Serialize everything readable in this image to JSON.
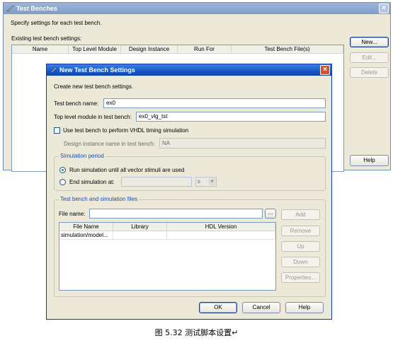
{
  "back_window": {
    "title": "Test Benches",
    "subtitle": "Specify settings for each test bench.",
    "existing_label": "Existing test bench settings:",
    "columns": [
      "Name",
      "Top Level Module",
      "Design Instance",
      "Run For",
      "Test Bench File(s)"
    ],
    "buttons": {
      "new": "New...",
      "edit": "Edit...",
      "delete": "Delete",
      "help": "Help"
    }
  },
  "dialog": {
    "title": "New Test Bench Settings",
    "intro": "Create new test bench settings.",
    "test_bench_name_label": "Test bench name:",
    "test_bench_name_value": "ex0",
    "top_level_label": "Top level module in test bench:",
    "top_level_value": "ex0_vlg_tst",
    "use_vhdl_label": "Use test bench to perform VHDL timing simulation",
    "use_vhdl_checked": false,
    "design_instance_label": "Design instance name in test bench:",
    "design_instance_value": "NA",
    "sim_period": {
      "title": "Simulation period",
      "run_until_label": "Run simulation until all vector stimuli are used",
      "run_until_checked": true,
      "end_at_label": "End simulation at:",
      "end_at_value": "",
      "end_at_unit": "s"
    },
    "files": {
      "title": "Test bench and simulation files",
      "file_name_label": "File name:",
      "file_name_value": "",
      "browse_label": "...",
      "columns": [
        "File Name",
        "Library",
        "HDL Version"
      ],
      "rows": [
        {
          "file_name": "simulation/model...",
          "library": "",
          "hdl_version": ""
        }
      ],
      "buttons": {
        "add": "Add",
        "remove": "Remove",
        "up": "Up",
        "down": "Down",
        "properties": "Properties..."
      }
    },
    "footer": {
      "ok": "OK",
      "cancel": "Cancel",
      "help": "Help"
    }
  },
  "caption": "图 5.32  测试脚本设置↵",
  "colors": {
    "titlebar_active": "#1656c8",
    "titlebar_inactive": "#7f9cc7",
    "group_title": "#1d4da8",
    "window_bg": "#ece9d8"
  }
}
